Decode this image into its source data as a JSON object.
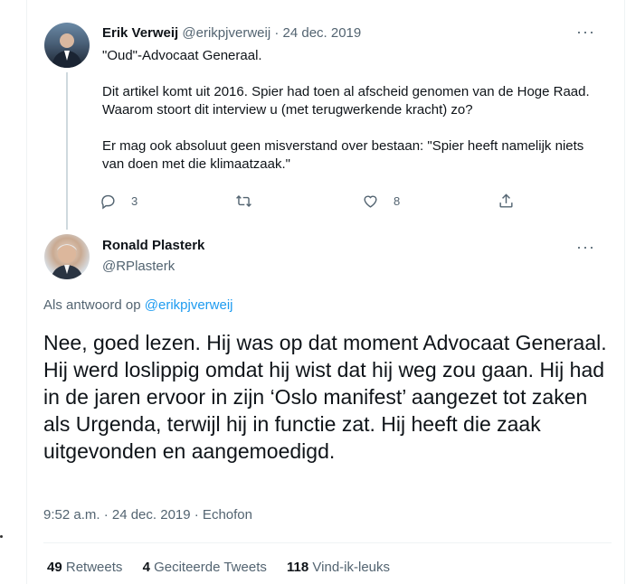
{
  "tweet1": {
    "author_name": "Erik Verweij",
    "handle": "@erikpjverweij",
    "separator": "·",
    "date": "24 dec. 2019",
    "more_label": "···",
    "paragraphs": [
      "\"Oud\"-Advocaat Generaal.",
      "Dit artikel komt uit 2016. Spier had toen al afscheid genomen van de Hoge Raad. Waarom stoort dit interview u (met terugwerkende kracht) zo?",
      "Er mag ook absoluut geen misverstand over bestaan: \"Spier heeft namelijk niets van doen met die klimaatzaak.\""
    ],
    "actions": {
      "reply_icon": "reply-icon",
      "reply_count": "3",
      "retweet_icon": "retweet-icon",
      "like_icon": "heart-icon",
      "like_count": "8",
      "share_icon": "share-icon"
    }
  },
  "tweet2": {
    "author_name": "Ronald Plasterk",
    "handle": "@RPlasterk",
    "more_label": "···",
    "reply_prefix": "Als antwoord op",
    "reply_to": "@erikpjverweij",
    "text": "Nee, goed lezen. Hij was op dat moment Advocaat Generaal. Hij werd loslippig omdat hij wist dat hij weg zou gaan. Hij had in de jaren ervoor in zijn ‘Oslo manifest’ aangezet tot zaken als Urgenda, terwijl hij in functie zat. Hij heeft die zaak uitgevonden en aangemoedigd.",
    "meta": "9:52 a.m. · 24 dec. 2019 · Echofon",
    "stats": {
      "retweets_count": "49",
      "retweets_label": "Retweets",
      "quotes_count": "4",
      "quotes_label": "Geciteerde Tweets",
      "likes_count": "118",
      "likes_label": "Vind-ik-leuks"
    }
  },
  "colors": {
    "text": "#0f1419",
    "muted": "#536471",
    "link": "#1d9bf0",
    "border": "#eff3f4"
  }
}
